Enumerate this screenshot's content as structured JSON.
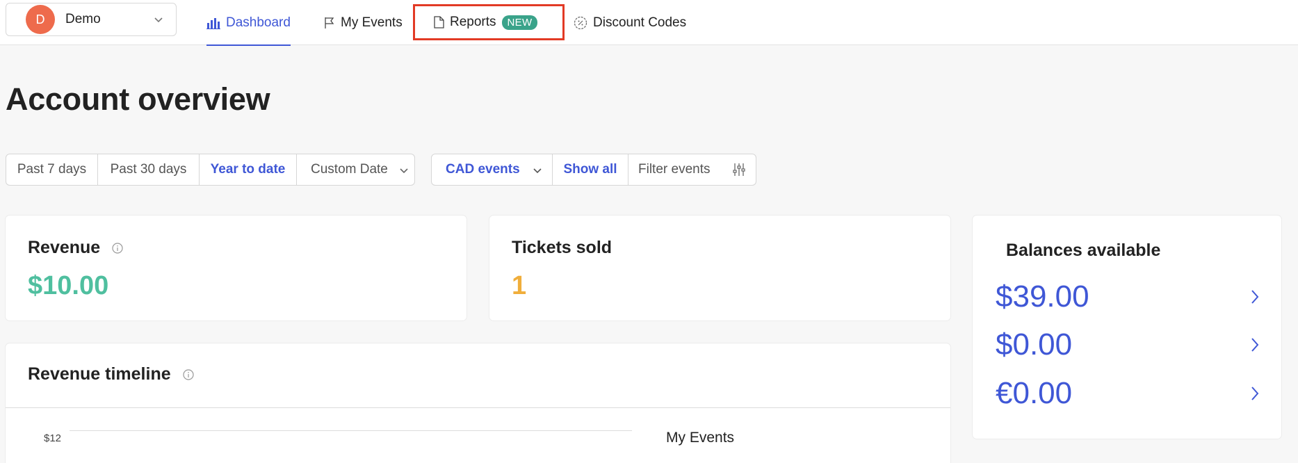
{
  "account": {
    "initial": "D",
    "name": "Demo"
  },
  "nav": {
    "dashboard": "Dashboard",
    "my_events": "My Events",
    "reports": "Reports",
    "reports_badge": "NEW",
    "discount_codes": "Discount Codes"
  },
  "page": {
    "title": "Account overview"
  },
  "date_filter": {
    "options": [
      "Past 7 days",
      "Past 30 days",
      "Year to date",
      "Custom Date"
    ],
    "selected": "Year to date"
  },
  "event_filter": {
    "currency": "CAD events",
    "show_all": "Show all",
    "filter_placeholder": "Filter events"
  },
  "revenue": {
    "title": "Revenue",
    "value": "$10.00"
  },
  "tickets": {
    "title": "Tickets sold",
    "value": "1"
  },
  "balances": {
    "title": "Balances available",
    "items": [
      {
        "amount": "$39.00"
      },
      {
        "amount": "$0.00"
      },
      {
        "amount": "€0.00"
      }
    ]
  },
  "timeline": {
    "title": "Revenue timeline",
    "y_tick": "$12",
    "legend_title": "My Events"
  },
  "colors": {
    "accent": "#3f57d6",
    "revenue": "#4fbf9f",
    "tickets": "#f0ae3b",
    "avatar": "#ee6b4c",
    "badge": "#3aa38a",
    "highlight": "#e23a25"
  }
}
